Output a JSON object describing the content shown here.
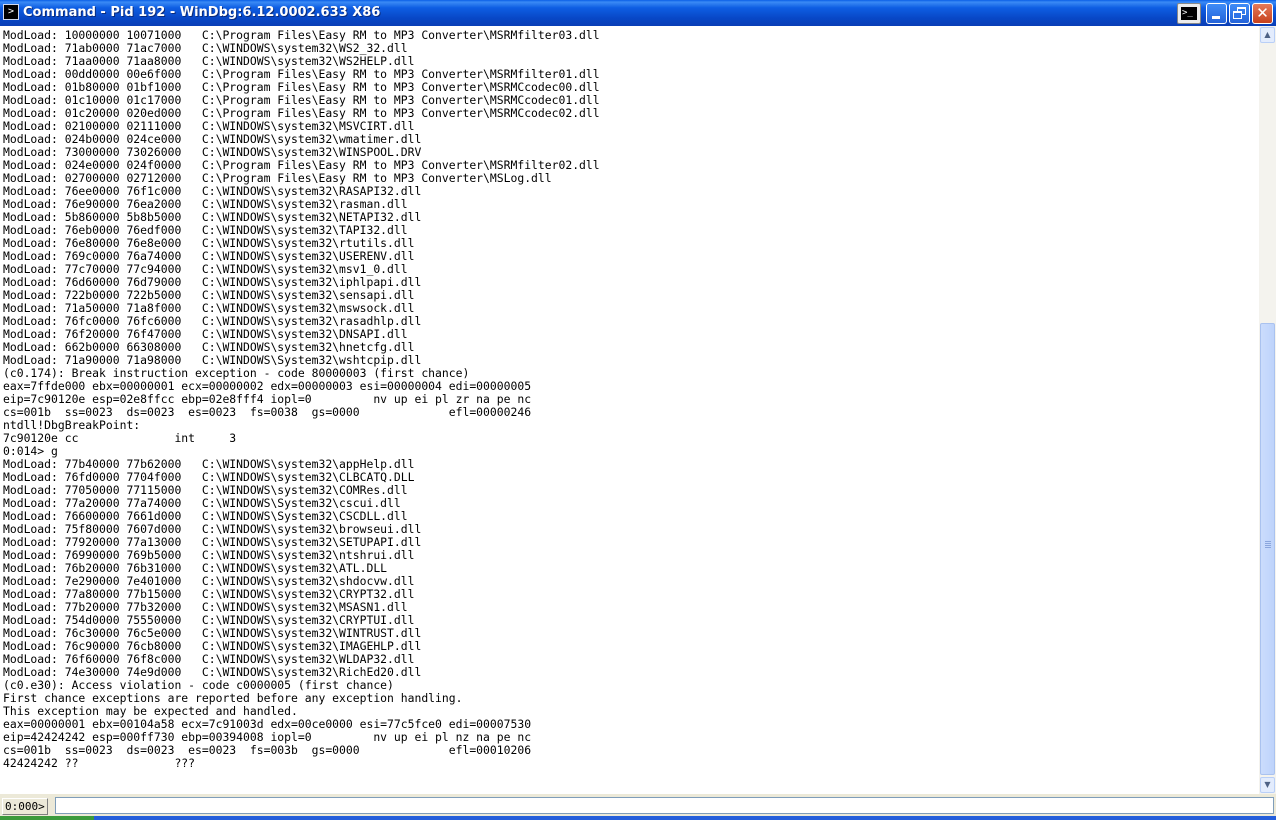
{
  "window": {
    "title": "Command - Pid 192 - WinDbg:6.12.0002.633 X86",
    "icon": "console-icon"
  },
  "titlebar_buttons": {
    "cmd_icon": "command-window-icon",
    "minimize": "minimize-icon",
    "maximize": "restore-icon",
    "close": "close-icon",
    "close_glyph": "✕"
  },
  "output": {
    "lines": [
      "ModLoad: 10000000 10071000   C:\\Program Files\\Easy RM to MP3 Converter\\MSRMfilter03.dll",
      "ModLoad: 71ab0000 71ac7000   C:\\WINDOWS\\system32\\WS2_32.dll",
      "ModLoad: 71aa0000 71aa8000   C:\\WINDOWS\\system32\\WS2HELP.dll",
      "ModLoad: 00dd0000 00e6f000   C:\\Program Files\\Easy RM to MP3 Converter\\MSRMfilter01.dll",
      "ModLoad: 01b80000 01bf1000   C:\\Program Files\\Easy RM to MP3 Converter\\MSRMCcodec00.dll",
      "ModLoad: 01c10000 01c17000   C:\\Program Files\\Easy RM to MP3 Converter\\MSRMCcodec01.dll",
      "ModLoad: 01c20000 020ed000   C:\\Program Files\\Easy RM to MP3 Converter\\MSRMCcodec02.dll",
      "ModLoad: 02100000 02111000   C:\\WINDOWS\\system32\\MSVCIRT.dll",
      "ModLoad: 024b0000 024ce000   C:\\WINDOWS\\system32\\wmatimer.dll",
      "ModLoad: 73000000 73026000   C:\\WINDOWS\\system32\\WINSPOOL.DRV",
      "ModLoad: 024e0000 024f0000   C:\\Program Files\\Easy RM to MP3 Converter\\MSRMfilter02.dll",
      "ModLoad: 02700000 02712000   C:\\Program Files\\Easy RM to MP3 Converter\\MSLog.dll",
      "ModLoad: 76ee0000 76f1c000   C:\\WINDOWS\\system32\\RASAPI32.dll",
      "ModLoad: 76e90000 76ea2000   C:\\WINDOWS\\system32\\rasman.dll",
      "ModLoad: 5b860000 5b8b5000   C:\\WINDOWS\\system32\\NETAPI32.dll",
      "ModLoad: 76eb0000 76edf000   C:\\WINDOWS\\system32\\TAPI32.dll",
      "ModLoad: 76e80000 76e8e000   C:\\WINDOWS\\system32\\rtutils.dll",
      "ModLoad: 769c0000 76a74000   C:\\WINDOWS\\system32\\USERENV.dll",
      "ModLoad: 77c70000 77c94000   C:\\WINDOWS\\system32\\msv1_0.dll",
      "ModLoad: 76d60000 76d79000   C:\\WINDOWS\\system32\\iphlpapi.dll",
      "ModLoad: 722b0000 722b5000   C:\\WINDOWS\\system32\\sensapi.dll",
      "ModLoad: 71a50000 71a8f000   C:\\WINDOWS\\system32\\mswsock.dll",
      "ModLoad: 76fc0000 76fc6000   C:\\WINDOWS\\system32\\rasadhlp.dll",
      "ModLoad: 76f20000 76f47000   C:\\WINDOWS\\system32\\DNSAPI.dll",
      "ModLoad: 662b0000 66308000   C:\\WINDOWS\\system32\\hnetcfg.dll",
      "ModLoad: 71a90000 71a98000   C:\\WINDOWS\\System32\\wshtcpip.dll",
      "(c0.174): Break instruction exception - code 80000003 (first chance)",
      "eax=7ffde000 ebx=00000001 ecx=00000002 edx=00000003 esi=00000004 edi=00000005",
      "eip=7c90120e esp=02e8ffcc ebp=02e8fff4 iopl=0         nv up ei pl zr na pe nc",
      "cs=001b  ss=0023  ds=0023  es=0023  fs=0038  gs=0000             efl=00000246",
      "ntdll!DbgBreakPoint:",
      "7c90120e cc              int     3",
      "0:014> g",
      "ModLoad: 77b40000 77b62000   C:\\WINDOWS\\system32\\appHelp.dll",
      "ModLoad: 76fd0000 7704f000   C:\\WINDOWS\\system32\\CLBCATQ.DLL",
      "ModLoad: 77050000 77115000   C:\\WINDOWS\\system32\\COMRes.dll",
      "ModLoad: 77a20000 77a74000   C:\\WINDOWS\\System32\\cscui.dll",
      "ModLoad: 76600000 7661d000   C:\\WINDOWS\\System32\\CSCDLL.dll",
      "ModLoad: 75f80000 7607d000   C:\\WINDOWS\\system32\\browseui.dll",
      "ModLoad: 77920000 77a13000   C:\\WINDOWS\\system32\\SETUPAPI.dll",
      "ModLoad: 76990000 769b5000   C:\\WINDOWS\\system32\\ntshrui.dll",
      "ModLoad: 76b20000 76b31000   C:\\WINDOWS\\system32\\ATL.DLL",
      "ModLoad: 7e290000 7e401000   C:\\WINDOWS\\system32\\shdocvw.dll",
      "ModLoad: 77a80000 77b15000   C:\\WINDOWS\\system32\\CRYPT32.dll",
      "ModLoad: 77b20000 77b32000   C:\\WINDOWS\\system32\\MSASN1.dll",
      "ModLoad: 754d0000 75550000   C:\\WINDOWS\\system32\\CRYPTUI.dll",
      "ModLoad: 76c30000 76c5e000   C:\\WINDOWS\\system32\\WINTRUST.dll",
      "ModLoad: 76c90000 76cb8000   C:\\WINDOWS\\system32\\IMAGEHLP.dll",
      "ModLoad: 76f60000 76f8c000   C:\\WINDOWS\\system32\\WLDAP32.dll",
      "ModLoad: 74e30000 74e9d000   C:\\WINDOWS\\system32\\RichEd20.dll",
      "(c0.e30): Access violation - code c0000005 (first chance)",
      "First chance exceptions are reported before any exception handling.",
      "This exception may be expected and handled.",
      "eax=00000001 ebx=00104a58 ecx=7c91003d edx=00ce0000 esi=77c5fce0 edi=00007530",
      "eip=42424242 esp=000ff730 ebp=00394008 iopl=0         nv up ei pl nz na pe nc",
      "cs=001b  ss=0023  ds=0023  es=0023  fs=003b  gs=0000             efl=00010206",
      "42424242 ??              ???"
    ]
  },
  "scrollbar": {
    "up_arrow": "▲",
    "down_arrow": "▼",
    "up_icon": "scroll-up-icon",
    "down_icon": "scroll-down-icon"
  },
  "command": {
    "prompt": "0:000>",
    "input_value": ""
  }
}
